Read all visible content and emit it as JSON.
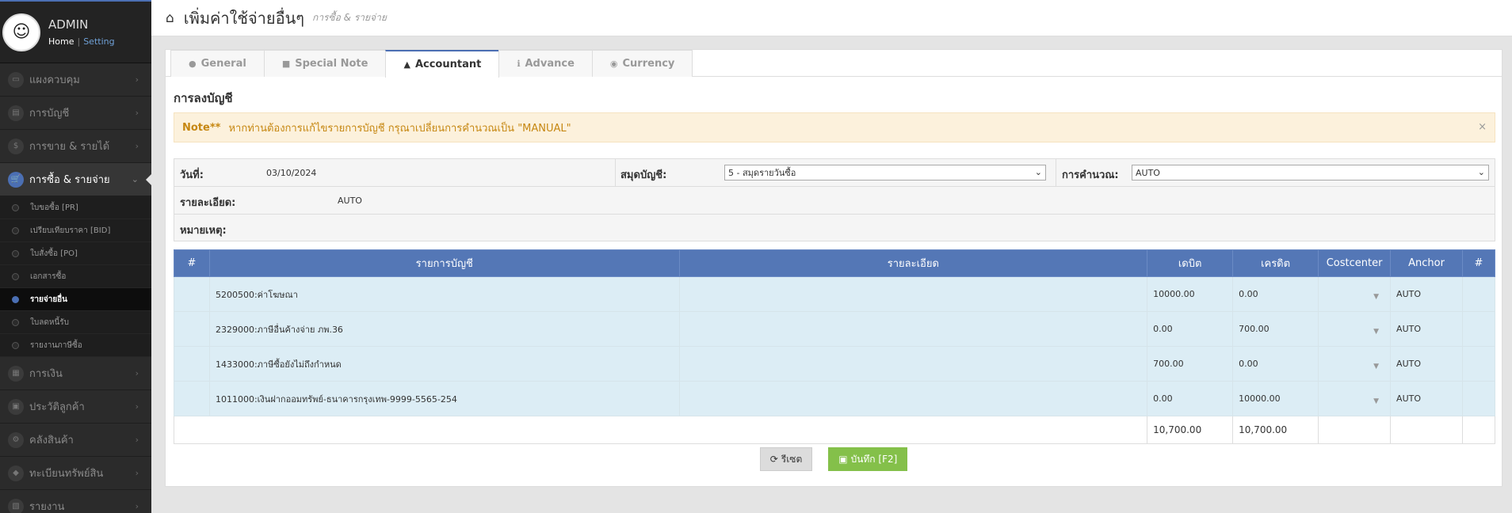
{
  "profile": {
    "name": "ADMIN",
    "home": "Home",
    "sep": "|",
    "setting": "Setting"
  },
  "menu": [
    {
      "label": "แผงควบคุม",
      "icon": "▭"
    },
    {
      "label": "การบัญชี",
      "icon": "▤"
    },
    {
      "label": "การขาย & รายได้",
      "icon": "$"
    },
    {
      "label": "การซื้อ & รายจ่าย",
      "icon": "🛒"
    },
    {
      "label": "การเงิน",
      "icon": "▦"
    },
    {
      "label": "ประวัติลูกค้า",
      "icon": "▣"
    },
    {
      "label": "คลังสินค้า",
      "icon": "⚙"
    },
    {
      "label": "ทะเบียนทรัพย์สิน",
      "icon": "◆"
    },
    {
      "label": "รายงาน",
      "icon": "▧"
    }
  ],
  "submenu": [
    "ใบขอซื้อ [PR]",
    "เปรียบเทียบราคา [BID]",
    "ใบสั่งซื้อ [PO]",
    "เอกสารซื้อ",
    "รายจ่ายอื่น",
    "ใบลดหนี้รับ",
    "รายงานภาษีซื้อ"
  ],
  "header": {
    "title": "เพิ่มค่าใช้จ่ายอื่นๆ",
    "subtitle": "การซื้อ & รายจ่าย"
  },
  "tabs": [
    "General",
    "Special Note",
    "Accountant",
    "Advance",
    "Currency"
  ],
  "section_title": "การลงบัญชี",
  "alert": {
    "label": "Note**",
    "text": "หากท่านต้องการแก้ไขรายการบัญชี กรุณาเปลี่ยนการคำนวณเป็น \"MANUAL\"",
    "close": "×"
  },
  "form": {
    "date_label": "วันที่:",
    "date_value": "03/10/2024",
    "journal_label": "สมุดบัญชี:",
    "journal_value": "5 - สมุดรายวันซื้อ",
    "calc_label": "การคำนวณ:",
    "calc_value": "AUTO",
    "detail_label": "รายละเอียด:",
    "detail_value": "AUTO",
    "remark_label": "หมายเหตุ:"
  },
  "table": {
    "headers": [
      "#",
      "รายการบัญชี",
      "รายละเอียด",
      "เดบิต",
      "เครดิต",
      "Costcenter",
      "Anchor",
      "#"
    ],
    "rows": [
      {
        "account": "5200500:ค่าโฆษณา",
        "debit": "10000.00",
        "credit": "0.00",
        "anchor": "AUTO"
      },
      {
        "account": "2329000:ภาษีอื่นค้างจ่าย ภพ.36",
        "debit": "0.00",
        "credit": "700.00",
        "anchor": "AUTO"
      },
      {
        "account": "1433000:ภาษีซื้อยังไม่ถึงกำหนด",
        "debit": "700.00",
        "credit": "0.00",
        "anchor": "AUTO"
      },
      {
        "account": "1011000:เงินฝากออมทรัพย์-ธนาคารกรุงเทพ-9999-5565-254",
        "debit": "0.00",
        "credit": "10000.00",
        "anchor": "AUTO"
      }
    ],
    "total_debit": "10,700.00",
    "total_credit": "10,700.00"
  },
  "buttons": {
    "reset": "รีเซต",
    "save": "บันทึก [F2]"
  }
}
